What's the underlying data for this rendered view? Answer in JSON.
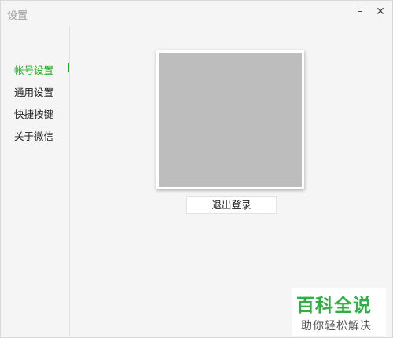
{
  "window": {
    "title": "设置",
    "minimize_glyph": "–",
    "close_glyph": "✕"
  },
  "sidebar": {
    "items": [
      {
        "label": "帐号设置",
        "active": true
      },
      {
        "label": "通用设置",
        "active": false
      },
      {
        "label": "快捷按键",
        "active": false
      },
      {
        "label": "关于微信",
        "active": false
      }
    ]
  },
  "main": {
    "logout_label": "退出登录"
  },
  "watermark": {
    "title": "百科全说",
    "subtitle": "助你轻松解决"
  },
  "colors": {
    "accent": "#1aad19",
    "avatar_placeholder": "#bdbdbd"
  }
}
